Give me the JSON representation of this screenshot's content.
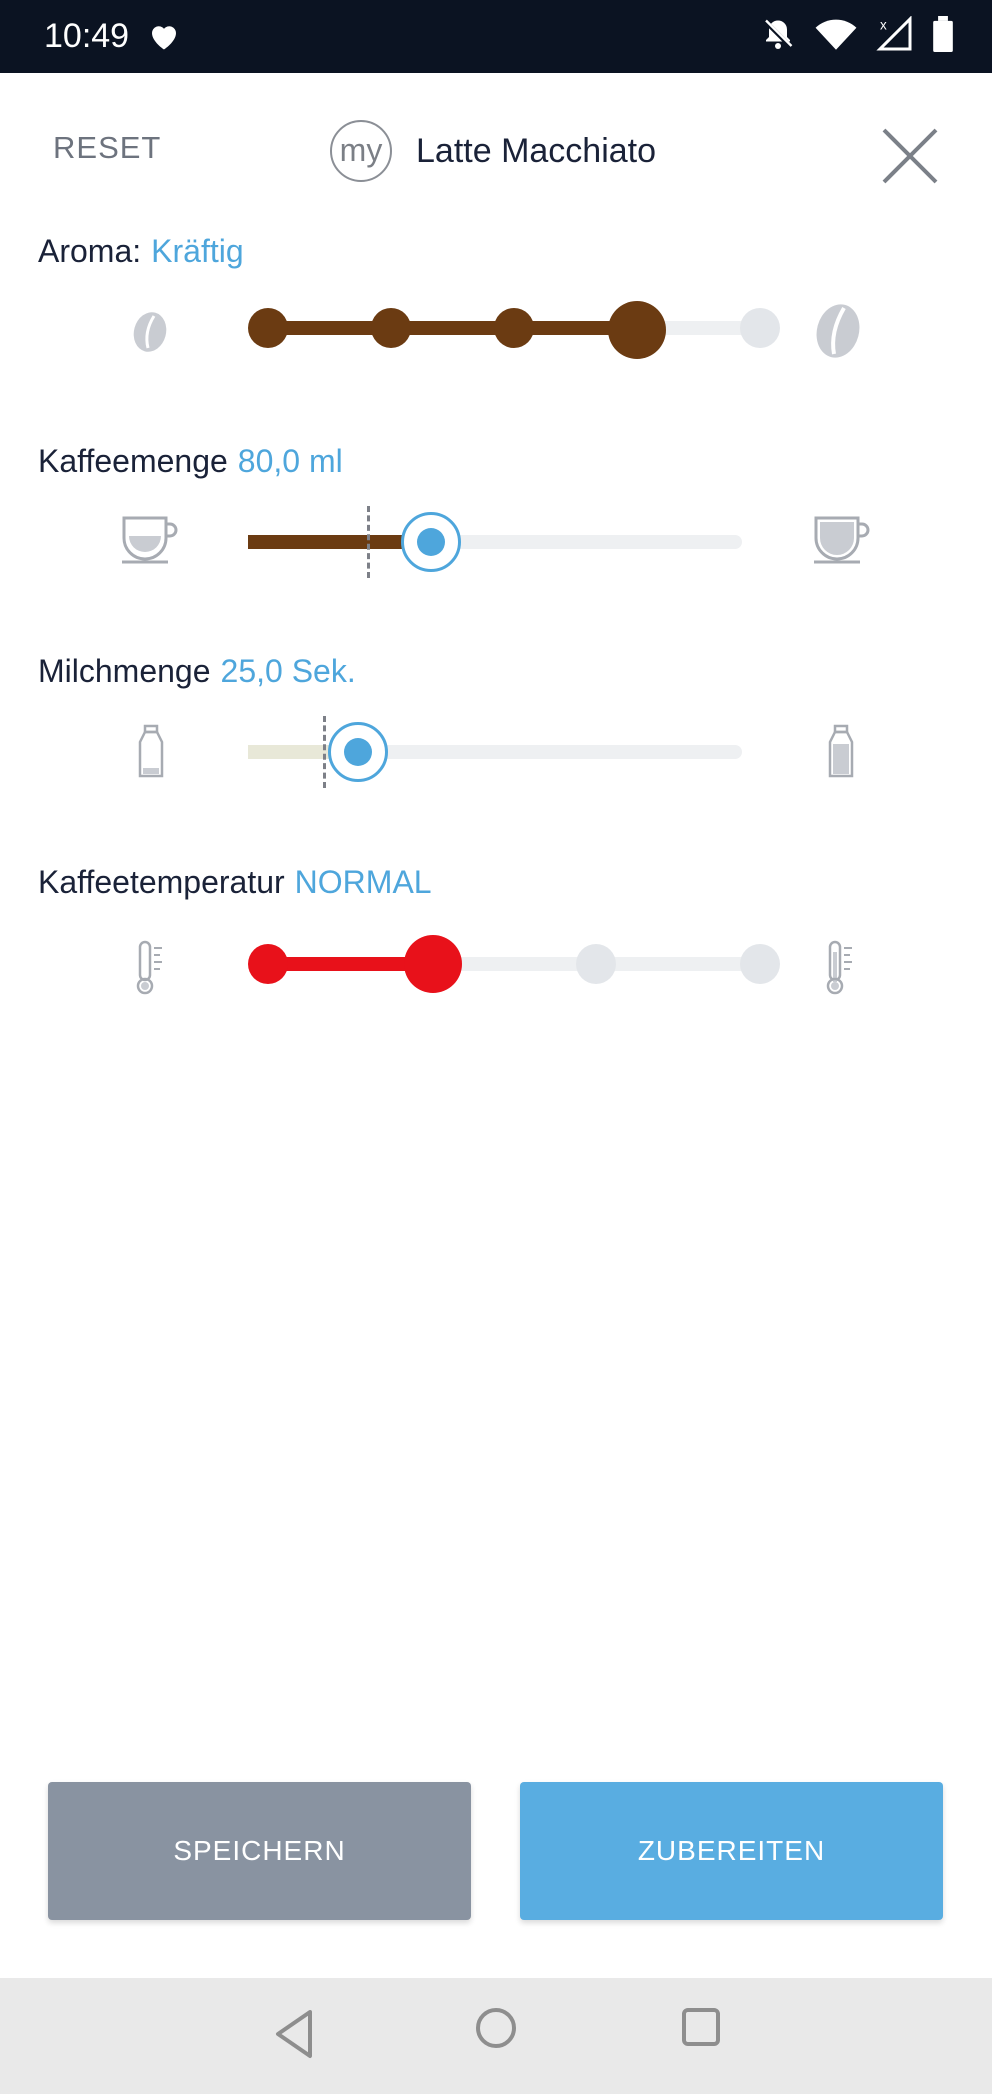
{
  "status_bar": {
    "time": "10:49"
  },
  "header": {
    "reset_label": "RESET",
    "badge": "my",
    "title": "Latte Macchiato"
  },
  "settings": {
    "aroma": {
      "label": "Aroma:",
      "value": "Kräftig",
      "level": 4,
      "max": 5
    },
    "coffee_amount": {
      "label": "Kaffeemenge",
      "value": "80,0 ml"
    },
    "milk_amount": {
      "label": "Milchmenge",
      "value": "25,0 Sek."
    },
    "temperature": {
      "label": "Kaffeetemperatur",
      "value": "NORMAL",
      "level": 2,
      "max": 4
    }
  },
  "buttons": {
    "save": "SPEICHERN",
    "brew": "ZUBEREITEN"
  },
  "colors": {
    "coffee_brown": "#6b3b12",
    "accent_blue": "#4ea6dc",
    "temp_red": "#e8111a",
    "milk_cream": "#e8e8d8"
  }
}
